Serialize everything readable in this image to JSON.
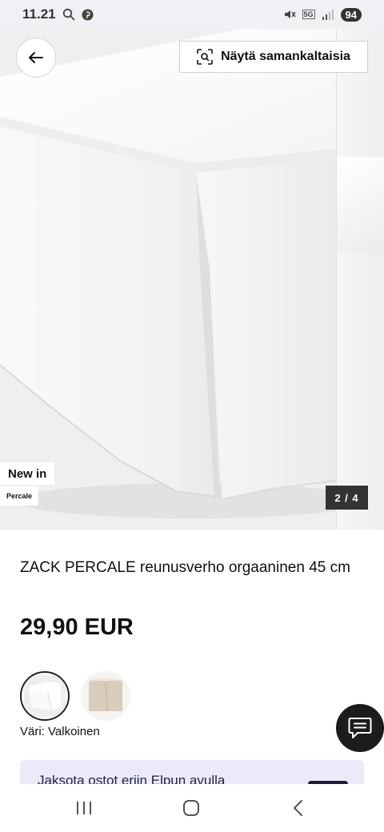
{
  "status_bar": {
    "time": "11.21",
    "network": "5G",
    "battery": "94"
  },
  "hero": {
    "back_icon": "arrow-left-icon",
    "similar_icon": "visual-search-icon",
    "similar_label": "Näytä samankaltaisia",
    "badge_new": "New in",
    "badge_material": "Percale",
    "image_counter": "2 / 4"
  },
  "product": {
    "title": "ZACK PERCALE reunusverho orgaaninen 45 cm",
    "price": "29,90 EUR",
    "color_label": "Väri: Valkoinen",
    "swatches": [
      {
        "color": "#ffffff",
        "selected": true
      },
      {
        "color": "#d8cdbd",
        "selected": false
      }
    ]
  },
  "chat": {
    "icon": "chat-bubble-icon"
  },
  "installment": {
    "text": "Jaksota ostot eriin Elpun avulla"
  },
  "nav_bar": {
    "recents_icon": "recent-apps-icon",
    "home_icon": "home-icon",
    "back_icon": "back-chevron-icon"
  }
}
